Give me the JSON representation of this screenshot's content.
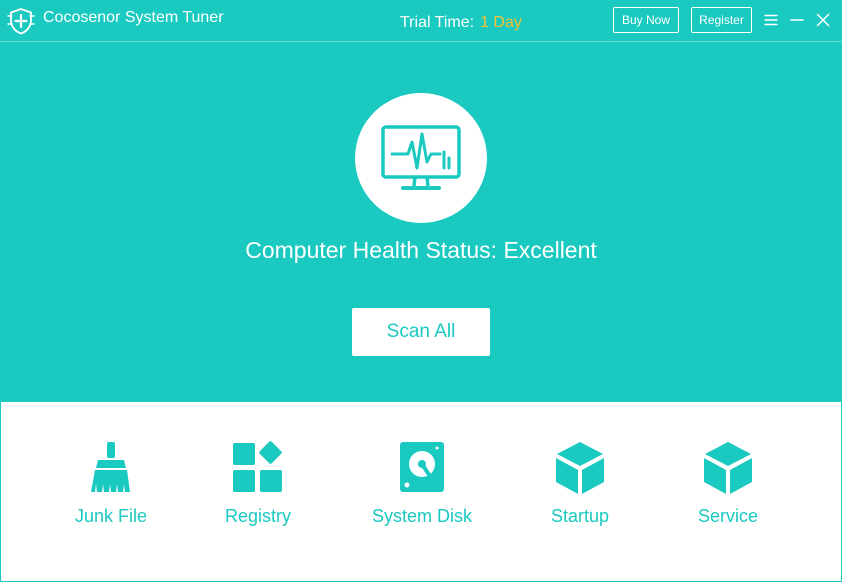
{
  "theme": {
    "accent": "#1ac9c0",
    "trial_highlight": "#f7c22f",
    "background": "#ffffff"
  },
  "titlebar": {
    "app_title": "Cocosenor System Tuner",
    "trial_label": "Trial Time:",
    "trial_value": "1 Day",
    "buy_now_label": "Buy Now",
    "register_label": "Register",
    "icons": {
      "logo": "shield-plus-icon",
      "menu": "hamburger-menu-icon",
      "minimize": "minimize-icon",
      "close": "close-icon"
    }
  },
  "main": {
    "health_icon": "monitor-heartbeat-icon",
    "health_status": "Computer Health Status: Excellent",
    "scan_all_label": "Scan All"
  },
  "tools": [
    {
      "label": "Junk File",
      "icon": "broom-icon"
    },
    {
      "label": "Registry",
      "icon": "registry-blocks-icon"
    },
    {
      "label": "System Disk",
      "icon": "hard-disk-icon"
    },
    {
      "label": "Startup",
      "icon": "cube-icon"
    },
    {
      "label": "Service",
      "icon": "cube-icon"
    }
  ]
}
